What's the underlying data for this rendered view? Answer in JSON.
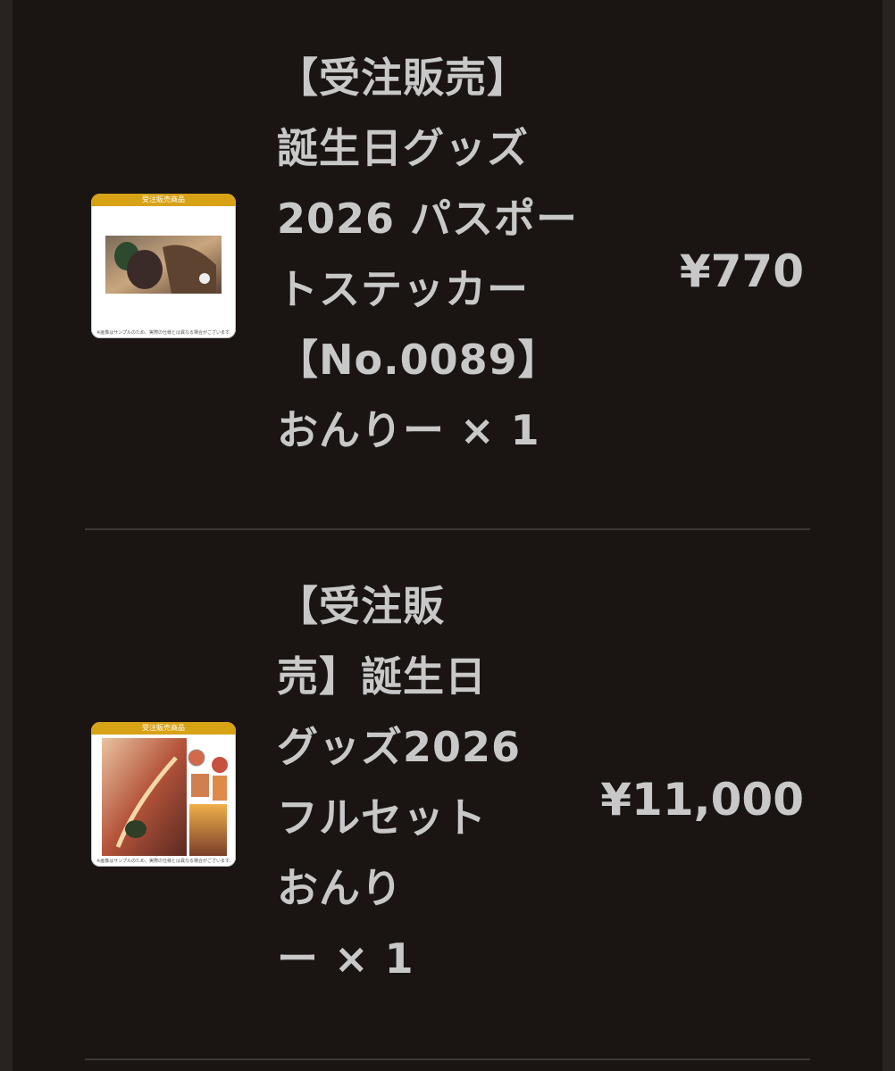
{
  "cart": {
    "items": [
      {
        "thumbnail": {
          "header_label": "受注販売商品",
          "footer_note": "※画像はサンプルのため、実際の仕様とは異なる場合がございます。",
          "icon": "sticker-product-image"
        },
        "name_lines": [
          "【受注販売】",
          "誕生日グッズ",
          "2026 パスポー",
          "トステッカー",
          "【No.0089】",
          "おんりー × 1"
        ],
        "price": "¥770"
      },
      {
        "thumbnail": {
          "header_label": "受注販売商品",
          "footer_note": "※画像はサンプルのため、実際の仕様とは異なる場合がございます。",
          "icon": "full-set-product-image"
        },
        "name_lines": [
          "【受注販",
          "売】誕生日",
          "グッズ2026",
          "フルセット",
          "おんり",
          "ー × 1"
        ],
        "price": "¥11,000"
      }
    ]
  },
  "colors": {
    "background": "#1a1513",
    "text": "#c8c8c8",
    "thumb_header": "#d8a215",
    "divider": "#3c3835"
  }
}
